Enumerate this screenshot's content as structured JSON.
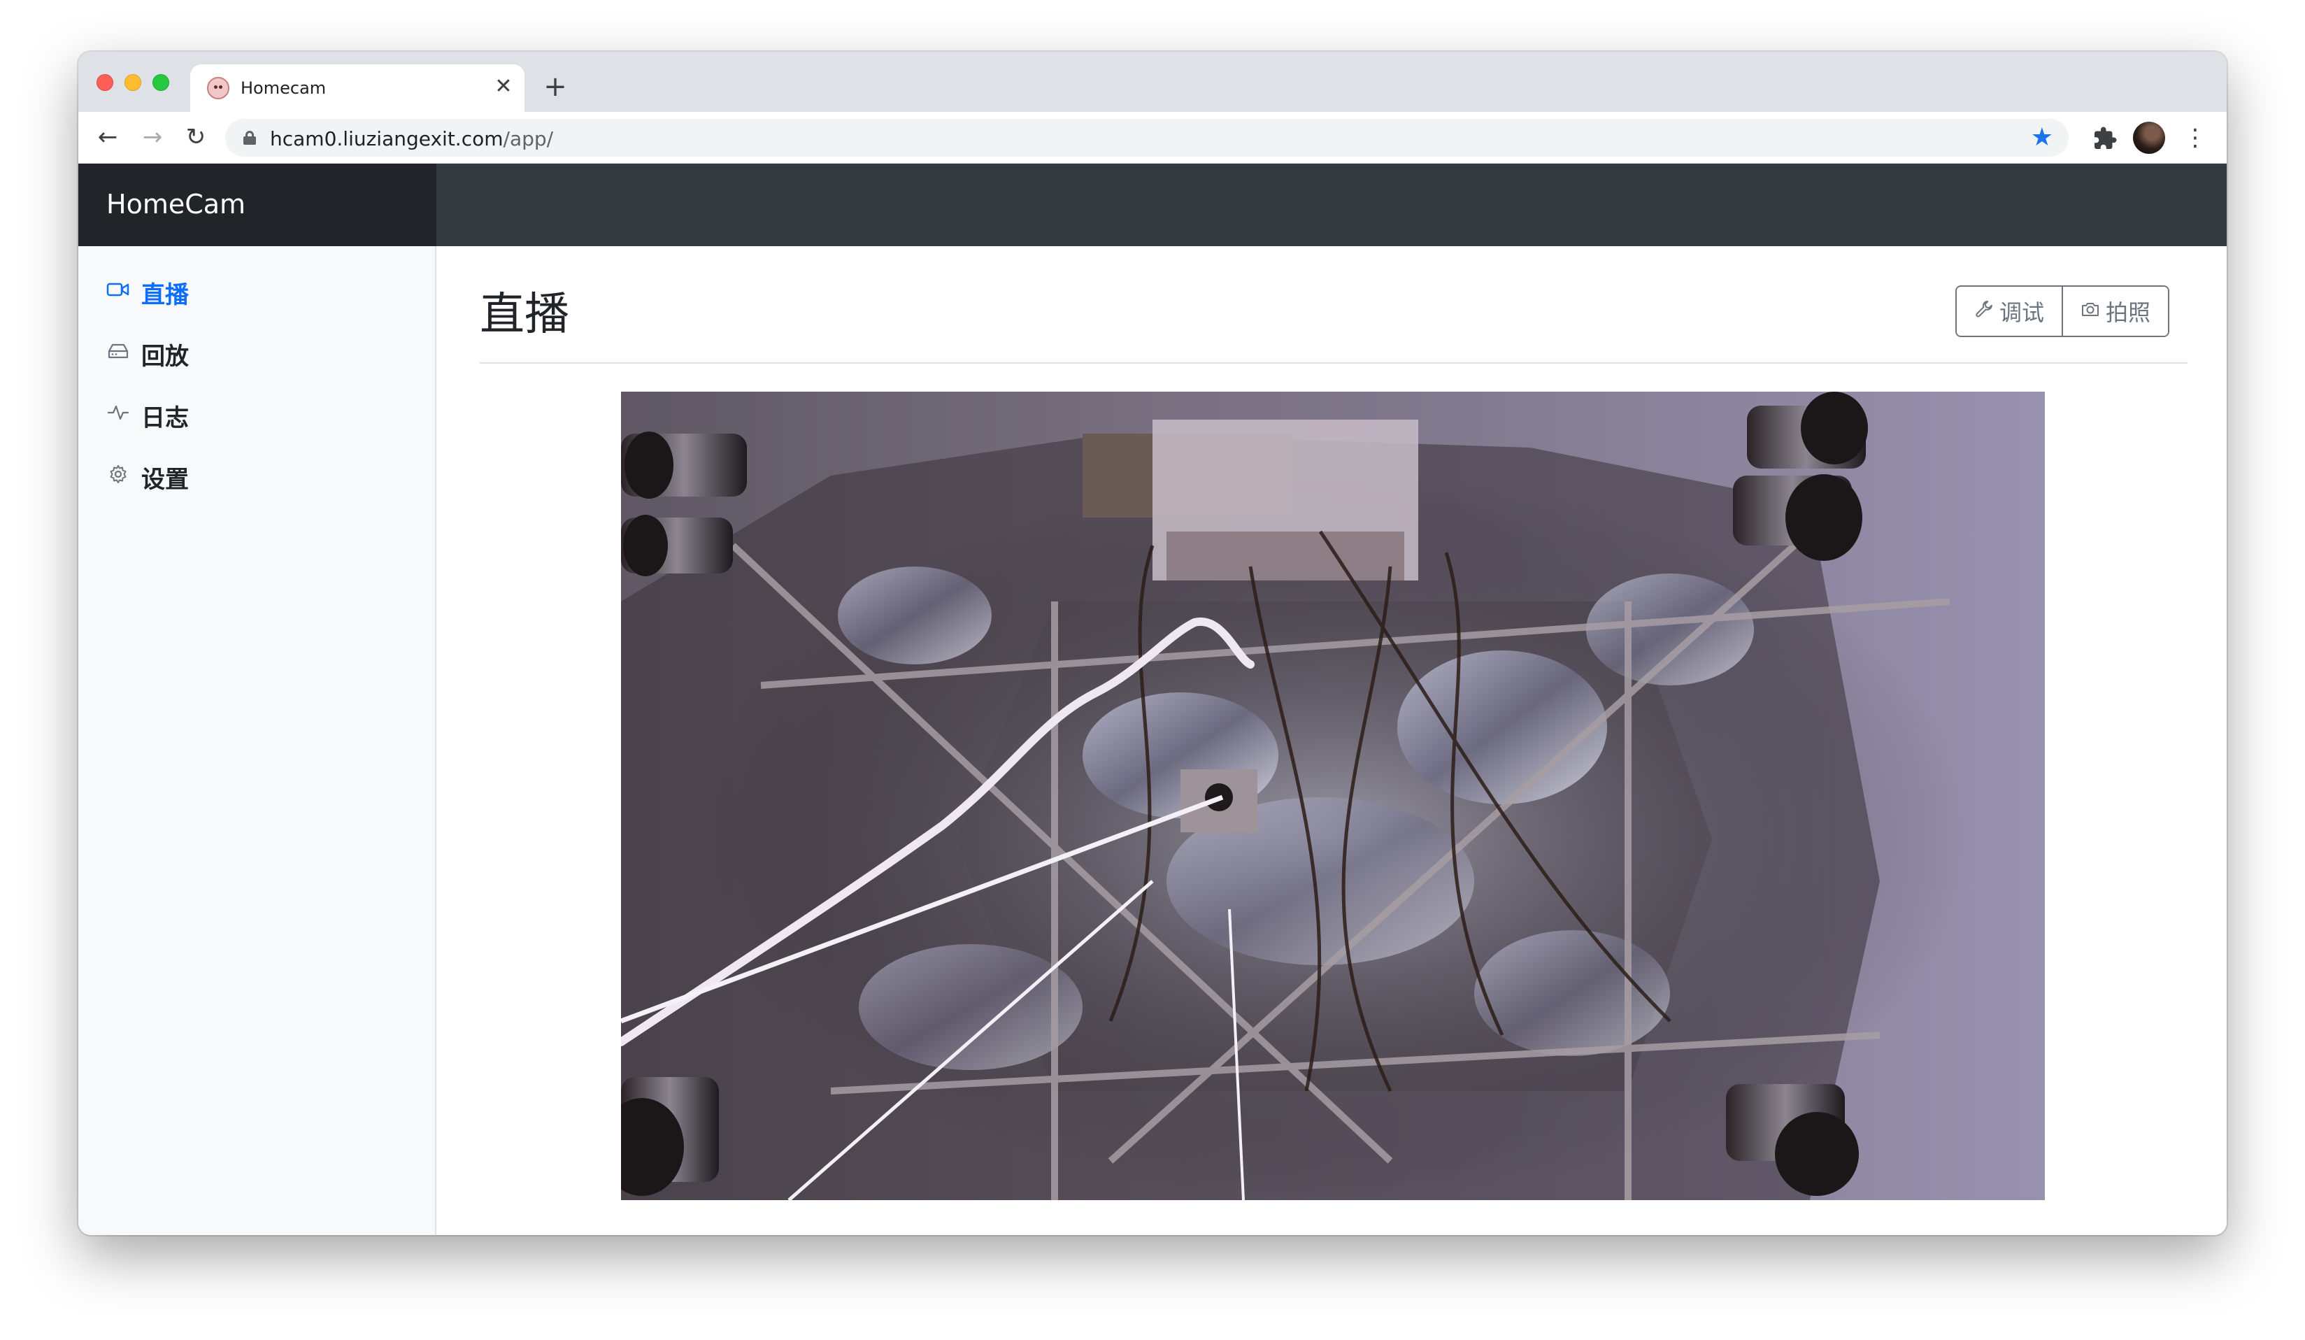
{
  "browser": {
    "tab_title": "Homecam",
    "tab_close_glyph": "✕",
    "new_tab_glyph": "+",
    "url_host": "hcam0.liuziangexit.com",
    "url_path": "/app/",
    "back_glyph": "←",
    "forward_glyph": "→",
    "reload_glyph": "↻",
    "star_glyph": "★",
    "menu_glyph": "⋮",
    "accent_color": "#1a73e8"
  },
  "app": {
    "brand": "HomeCam",
    "header_color": "#343a40",
    "brand_bg_color": "#212529",
    "active_color": "#0d6efd"
  },
  "sidebar": {
    "items": [
      {
        "label": "直播",
        "icon": "video-camera-icon",
        "active": true
      },
      {
        "label": "回放",
        "icon": "hard-drive-icon",
        "active": false
      },
      {
        "label": "日志",
        "icon": "activity-icon",
        "active": false
      },
      {
        "label": "设置",
        "icon": "gear-icon",
        "active": false
      }
    ]
  },
  "main": {
    "page_title": "直播",
    "buttons": {
      "debug_label": "调试",
      "debug_icon": "wrench-icon",
      "photo_label": "拍照",
      "photo_icon": "camera-icon"
    },
    "video": {
      "subject": "live-camera-feed"
    }
  }
}
